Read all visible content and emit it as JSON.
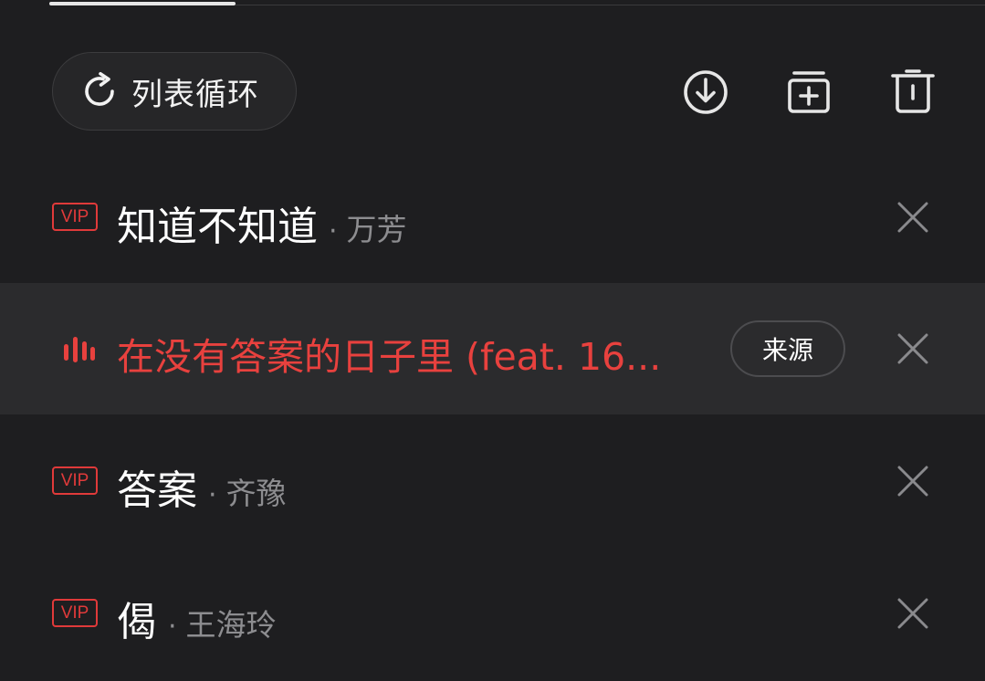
{
  "tab_strip": {
    "active_tab_indicator": "tab-underline"
  },
  "toolbar": {
    "loop_mode_label": "列表循环",
    "loop_icon": "repeat-icon",
    "download_icon": "download-icon",
    "add_to_playlist_icon": "add-to-playlist-icon",
    "delete_icon": "trash-icon"
  },
  "colors": {
    "background": "#1e1e20",
    "playing_row_background": "#2b2b2d",
    "accent_red": "#e8413e",
    "secondary_text": "#8d8d90"
  },
  "playlist": [
    {
      "badge": "VIP",
      "title": "知道不知道",
      "separator": "·",
      "artist": "万芳",
      "playing": false
    },
    {
      "indicator_icon": "now-playing-bars-icon",
      "title": "在没有答案的日子里 (feat. 16...",
      "source_label": "来源",
      "playing": true
    },
    {
      "badge": "VIP",
      "title": "答案",
      "separator": "·",
      "artist": "齐豫",
      "playing": false
    },
    {
      "badge": "VIP",
      "title": "偈",
      "separator": "·",
      "artist": "王海玲",
      "playing": false
    }
  ]
}
